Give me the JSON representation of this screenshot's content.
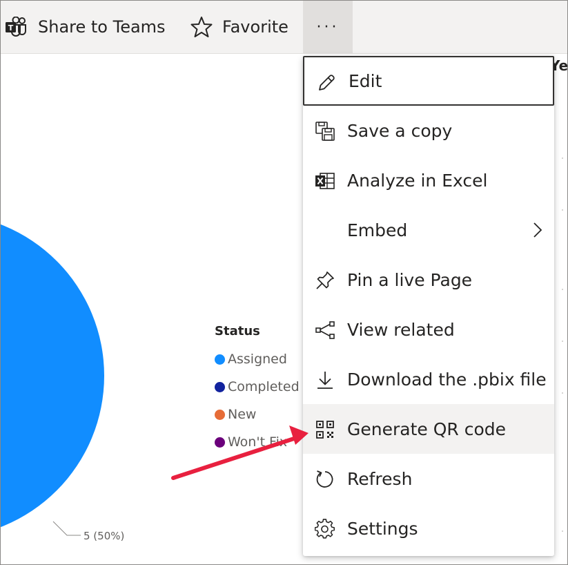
{
  "toolbar": {
    "share_teams_label": "Share to Teams",
    "favorite_label": "Favorite",
    "more_label": "···"
  },
  "menu": {
    "items": [
      {
        "label": "Edit",
        "icon": "pencil-icon"
      },
      {
        "label": "Save a copy",
        "icon": "save-copy-icon"
      },
      {
        "label": "Analyze in Excel",
        "icon": "excel-icon"
      },
      {
        "label": "Embed",
        "icon": "chevron-right-icon"
      },
      {
        "label": "Pin a live Page",
        "icon": "pin-icon"
      },
      {
        "label": "View related",
        "icon": "share-nodes-icon"
      },
      {
        "label": "Download the .pbix file",
        "icon": "download-icon"
      },
      {
        "label": "Generate QR code",
        "icon": "qr-code-icon"
      },
      {
        "label": "Refresh",
        "icon": "refresh-icon"
      },
      {
        "label": "Settings",
        "icon": "gear-icon"
      }
    ]
  },
  "report": {
    "header_fragment": "Ye",
    "pie_label": "5 (50%)",
    "legend": {
      "title": "Status",
      "items": [
        {
          "label": "Assigned",
          "color": "#118dff"
        },
        {
          "label": "Completed",
          "color": "#12239e"
        },
        {
          "label": "New",
          "color": "#e66c37"
        },
        {
          "label": "Won't Fix",
          "color": "#6b007b"
        }
      ]
    }
  },
  "colors": {
    "pie_fill": "#118dff",
    "annotation_arrow": "#e8203f",
    "toolbar_bg": "#f3f2f1"
  }
}
